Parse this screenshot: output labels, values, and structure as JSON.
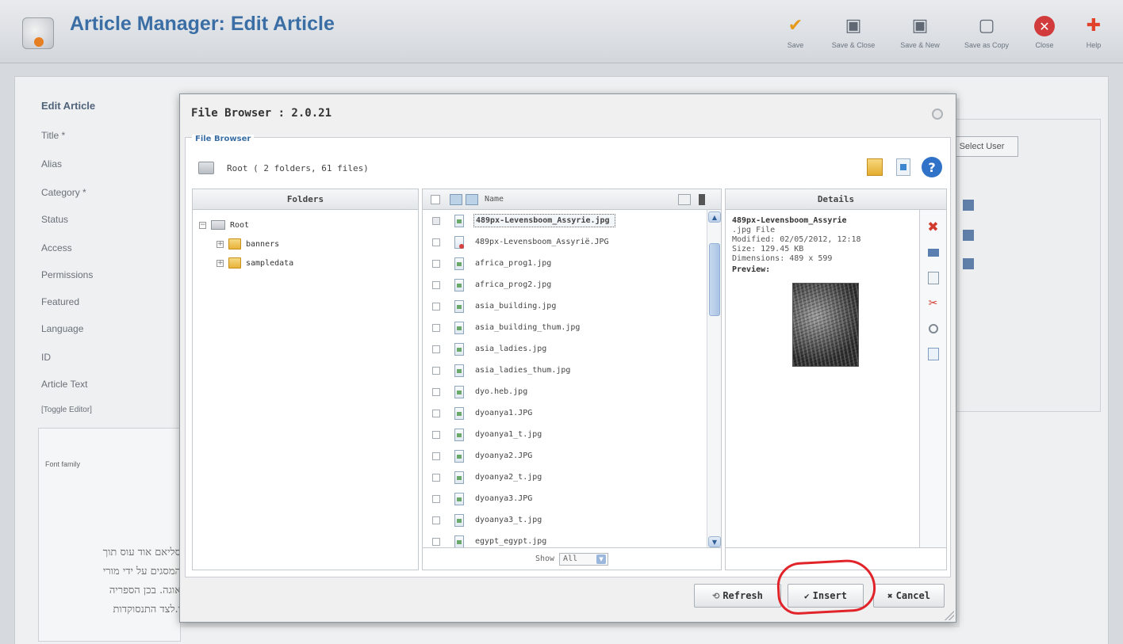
{
  "header": {
    "title": "Article Manager: Edit Article",
    "toolbar": [
      {
        "label": "Save",
        "icon": "checkmark-icon"
      },
      {
        "label": "Save & Close",
        "icon": "save-close-icon"
      },
      {
        "label": "Save & New",
        "icon": "save-new-icon"
      },
      {
        "label": "Save as Copy",
        "icon": "save-copy-icon"
      },
      {
        "label": "Close",
        "icon": "close-icon"
      },
      {
        "label": "Help",
        "icon": "help-icon"
      }
    ]
  },
  "background_form": {
    "legend": "Edit Article",
    "labels": [
      "Title *",
      "Alias",
      "Category *",
      "Status",
      "Access",
      "Permissions",
      "Featured",
      "Language",
      "ID",
      "Article Text",
      "[Toggle Editor]"
    ],
    "select_user_button": "Select User",
    "font_family": "Font family",
    "hebrew_text": [
      "סליאם אוד עוס תוך",
      "המסגים על ידי מורי",
      "אוגה. בכן הספריה",
      "ו.לצד התנסוקדות"
    ]
  },
  "dialog": {
    "title": "File Browser : 2.0.21",
    "legend": "File Browser",
    "path": "Root  ( 2 folders, 61 files)",
    "folders_header": "Folders",
    "folders": [
      {
        "name": "Root",
        "toggle": "−"
      },
      {
        "name": "banners",
        "toggle": "+"
      },
      {
        "name": "sampledata",
        "toggle": "+"
      }
    ],
    "files_header_name": "Name",
    "files": [
      {
        "name": "489px-Levensboom_Assyrie.jpg",
        "selected": true,
        "error": false
      },
      {
        "name": "489px-Levensboom_Assyrië.JPG",
        "selected": false,
        "error": true
      },
      {
        "name": "africa_prog1.jpg",
        "selected": false,
        "error": false
      },
      {
        "name": "africa_prog2.jpg",
        "selected": false,
        "error": false
      },
      {
        "name": "asia_building.jpg",
        "selected": false,
        "error": false
      },
      {
        "name": "asia_building_thum.jpg",
        "selected": false,
        "error": false
      },
      {
        "name": "asia_ladies.jpg",
        "selected": false,
        "error": false
      },
      {
        "name": "asia_ladies_thum.jpg",
        "selected": false,
        "error": false
      },
      {
        "name": "dyo.heb.jpg",
        "selected": false,
        "error": false
      },
      {
        "name": "dyoanya1.JPG",
        "selected": false,
        "error": false
      },
      {
        "name": "dyoanya1_t.jpg",
        "selected": false,
        "error": false
      },
      {
        "name": "dyoanya2.JPG",
        "selected": false,
        "error": false
      },
      {
        "name": "dyoanya2_t.jpg",
        "selected": false,
        "error": false
      },
      {
        "name": "dyoanya3.JPG",
        "selected": false,
        "error": false
      },
      {
        "name": "dyoanya3_t.jpg",
        "selected": false,
        "error": false
      },
      {
        "name": "egypt_egypt.jpg",
        "selected": false,
        "error": false
      }
    ],
    "show_label": "Show",
    "show_value": "All",
    "details_header": "Details",
    "details": {
      "name": "489px-Levensboom_Assyrie",
      "type": ".jpg File",
      "modified": "Modified: 02/05/2012, 12:18",
      "size": "Size: 129.45 KB",
      "dimensions": "Dimensions: 489 x 599",
      "preview_label": "Preview:"
    },
    "buttons": {
      "refresh": "Refresh",
      "insert": "Insert",
      "cancel": "Cancel"
    }
  },
  "colors": {
    "title_blue": "#3a6ea5",
    "highlight_red": "#e0242a"
  }
}
